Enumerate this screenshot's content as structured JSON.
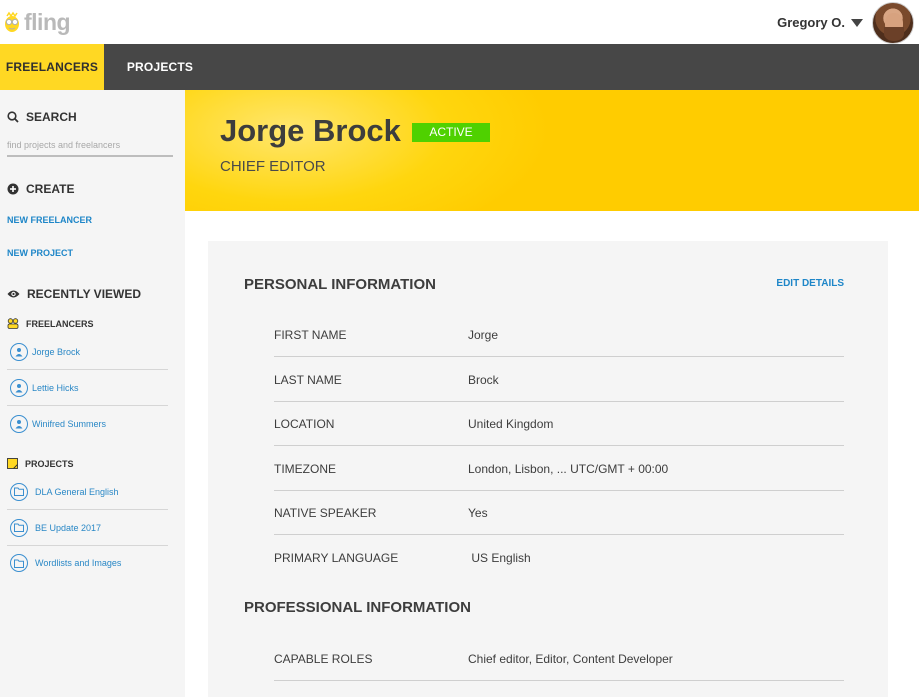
{
  "app": {
    "logo_text": "fling",
    "user_name": "Gregory O."
  },
  "nav": {
    "tabs": [
      {
        "label": "FREELANCERS",
        "active": true
      },
      {
        "label": "PROJECTS",
        "active": false
      }
    ]
  },
  "sidebar": {
    "search": {
      "title": "SEARCH",
      "placeholder": "find projects and freelancers"
    },
    "create": {
      "title": "CREATE",
      "links": [
        "NEW FREELANCER",
        "NEW PROJECT"
      ]
    },
    "recently_viewed": {
      "title": "RECENTLY VIEWED",
      "freelancers_title": "FREELANCERS",
      "freelancers": [
        "Jorge Brock",
        "Lettie Hicks",
        "Winifred Summers"
      ],
      "projects_title": "PROJECTS",
      "projects": [
        "DLA General English",
        "BE Update 2017",
        "Wordlists and Images"
      ]
    }
  },
  "profile": {
    "name": "Jorge Brock",
    "status": "ACTIVE",
    "role": "CHIEF EDITOR"
  },
  "personal": {
    "title": "PERSONAL INFORMATION",
    "edit_label": "EDIT DETAILS",
    "rows": [
      {
        "key": "FIRST NAME",
        "value": "Jorge"
      },
      {
        "key": "LAST NAME",
        "value": "Brock"
      },
      {
        "key": "LOCATION",
        "value": "United Kingdom"
      },
      {
        "key": "TIMEZONE",
        "value": "London, Lisbon, ... UTC/GMT + 00:00"
      },
      {
        "key": "NATIVE SPEAKER",
        "value": "Yes"
      },
      {
        "key": "PRIMARY LANGUAGE",
        "value": " US English"
      }
    ]
  },
  "professional": {
    "title": "PROFESSIONAL INFORMATION",
    "rows": [
      {
        "key": "CAPABLE ROLES",
        "value": "Chief editor, Editor, Content Developer"
      }
    ]
  },
  "colors": {
    "accent_yellow": "#ffd823",
    "nav_dark": "#474747",
    "link_blue": "#1e86c8",
    "status_green": "#4fd100"
  }
}
